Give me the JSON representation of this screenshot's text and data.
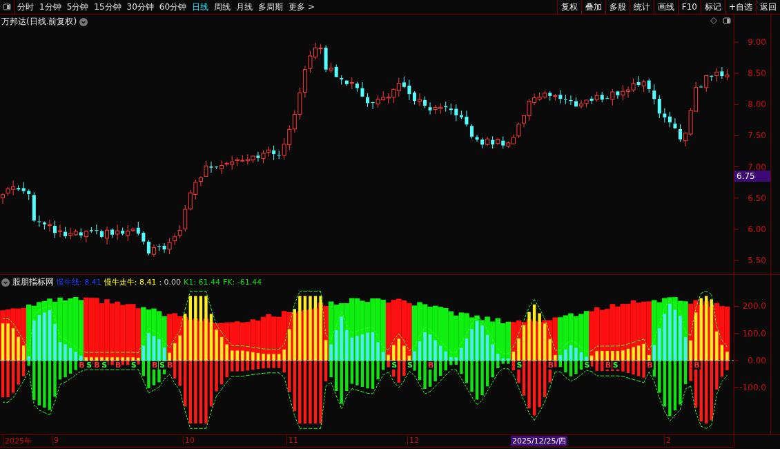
{
  "toolbar": {
    "periods": [
      {
        "label": "分时",
        "selected": false
      },
      {
        "label": "1分钟",
        "selected": false
      },
      {
        "label": "5分钟",
        "selected": false
      },
      {
        "label": "15分钟",
        "selected": false
      },
      {
        "label": "30分钟",
        "selected": false
      },
      {
        "label": "60分钟",
        "selected": false
      },
      {
        "label": "日线",
        "selected": true
      },
      {
        "label": "周线",
        "selected": false
      },
      {
        "label": "月线",
        "selected": false
      },
      {
        "label": "多周期",
        "selected": false
      },
      {
        "label": "更多 >",
        "selected": false
      }
    ],
    "actions": [
      "复权",
      "叠加",
      "多股",
      "统计",
      "画线",
      "F10",
      "标记",
      "+自选",
      "返回"
    ]
  },
  "main_chart": {
    "title": "万邦达(日线.前复权)",
    "price_ticks": [
      "9.00",
      "8.50",
      "8.00",
      "7.50",
      "7.00",
      "6.50",
      "6.00",
      "5.50"
    ],
    "price_marker": "6.75"
  },
  "indicator": {
    "name": "股朋指标网",
    "legend": [
      {
        "text": "慢牛线: 8.41",
        "color": "#1a3cff"
      },
      {
        "text": "慢牛走牛: 8.41",
        "color": "#ffff00"
      },
      {
        "text": ": 0.00",
        "color": "#c8c8c8"
      },
      {
        "text": "K1: 61.44",
        "color": "#18d818"
      },
      {
        "text": "FK: -61.44",
        "color": "#18d818"
      }
    ],
    "ticks": [
      "200.0",
      "100.0",
      "0.00",
      "-100.0"
    ],
    "signals": [
      {
        "label": "B",
        "kind": "buy"
      },
      {
        "label": "S",
        "kind": "sell"
      },
      {
        "label": "B",
        "kind": "buy"
      },
      {
        "label": "S",
        "kind": "sell"
      },
      {
        "label": "B",
        "kind": "buy"
      },
      {
        "label": "S",
        "kind": "sell"
      },
      {
        "label": "B",
        "kind": "buy"
      },
      {
        "label": "S",
        "kind": "sell"
      },
      {
        "label": "B",
        "kind": "buy"
      },
      {
        "label": "S",
        "kind": "sell"
      },
      {
        "label": "S",
        "kind": "sell"
      },
      {
        "label": "B",
        "kind": "buy"
      },
      {
        "label": "S",
        "kind": "sell"
      },
      {
        "label": "B",
        "kind": "buy"
      },
      {
        "label": "S",
        "kind": "sell"
      },
      {
        "label": "B",
        "kind": "buy"
      },
      {
        "label": "S",
        "kind": "sell"
      },
      {
        "label": "B",
        "kind": "buy"
      },
      {
        "label": "B",
        "kind": "buy"
      }
    ]
  },
  "date_axis": [
    {
      "label": "2025年",
      "kind": "year"
    },
    {
      "label": "9",
      "kind": "month"
    },
    {
      "label": "10",
      "kind": "month"
    },
    {
      "label": "11",
      "kind": "month"
    },
    {
      "label": "12",
      "kind": "month"
    },
    {
      "label": "2025/12/25/四",
      "kind": "cursor"
    },
    {
      "label": "2",
      "kind": "month"
    }
  ]
}
